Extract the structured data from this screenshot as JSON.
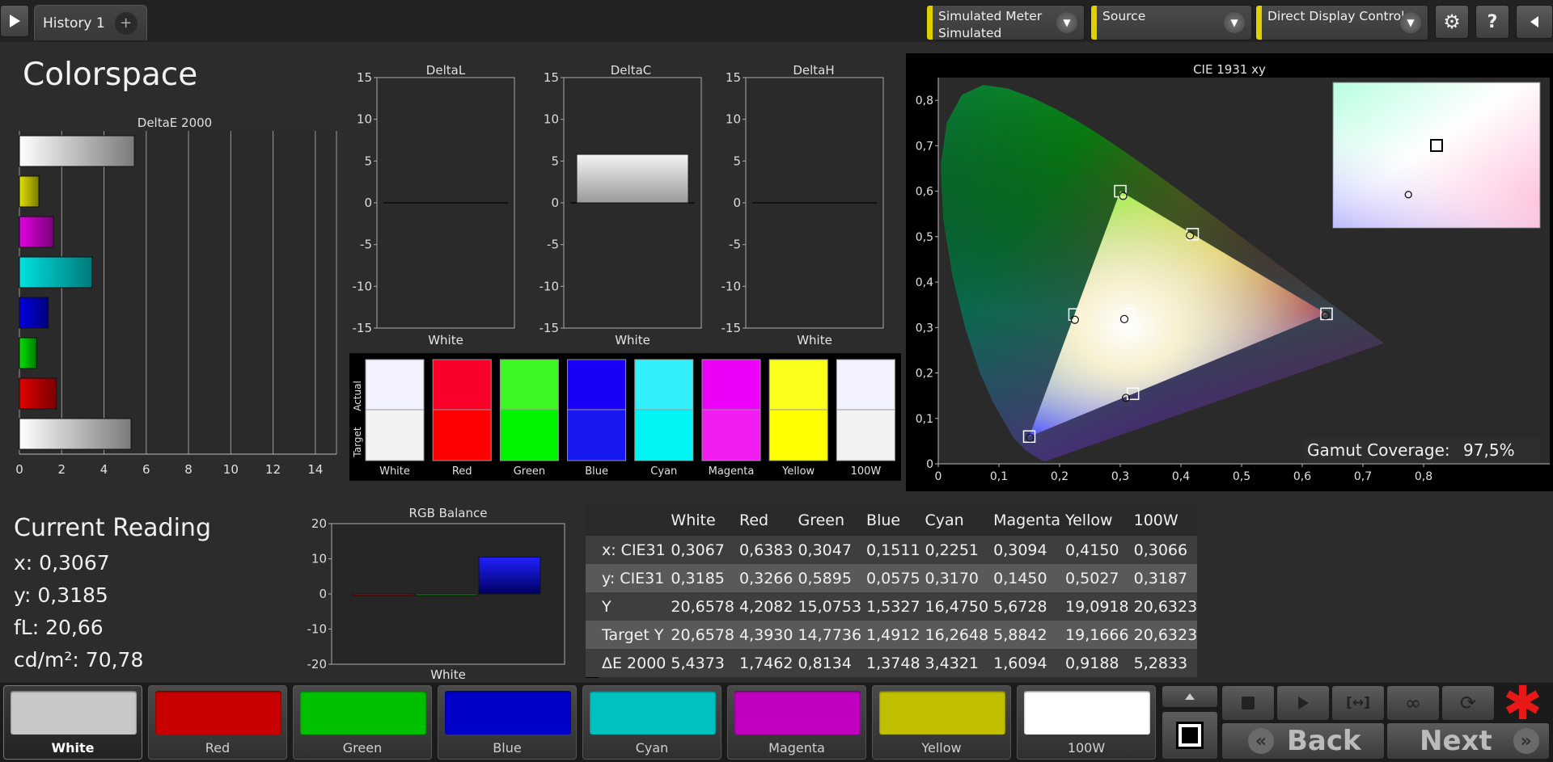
{
  "tabs": {
    "active_label": "History 1",
    "add_label": "+"
  },
  "dropdowns": [
    {
      "line1": "Simulated Meter",
      "line2": "Simulated"
    },
    {
      "line1": "Source",
      "line2": ""
    },
    {
      "line1": "Direct Display Control",
      "line2": ""
    }
  ],
  "icons": {
    "play": "play-icon",
    "settings": "gear-icon",
    "help": "help-icon",
    "collapse": "chevron-left-icon",
    "dropdown": "chevron-down-icon"
  },
  "page_title": "Colorspace",
  "deltaE_chart": {
    "type": "bar",
    "title": "DeltaE 2000",
    "categories": [
      "White",
      "Yellow",
      "Magenta",
      "Cyan",
      "Blue",
      "Green",
      "Red",
      "100W"
    ],
    "values": [
      5.4373,
      0.9188,
      1.6094,
      3.4321,
      1.3748,
      0.8134,
      1.7462,
      5.2833
    ],
    "xlim": [
      0,
      15
    ],
    "ticks": [
      "0",
      "2",
      "4",
      "6",
      "8",
      "10",
      "12",
      "14"
    ]
  },
  "delta_charts": [
    {
      "title": "DeltaL",
      "xlabel": "White",
      "value": 0.0
    },
    {
      "title": "DeltaC",
      "xlabel": "White",
      "value": 5.8
    },
    {
      "title": "DeltaH",
      "xlabel": "White",
      "value": 0.0
    }
  ],
  "delta_ticks": [
    "15",
    "10",
    "5",
    "0",
    "-5",
    "-10",
    "-15"
  ],
  "swatch_compare": {
    "actual_label": "Actual",
    "target_label": "Target",
    "items": [
      {
        "name": "White",
        "actual": "#f2f2fe",
        "target": "#f2f2f2"
      },
      {
        "name": "Red",
        "actual": "#f80028",
        "target": "#ff0000"
      },
      {
        "name": "Green",
        "actual": "#3cf722",
        "target": "#00f400"
      },
      {
        "name": "Blue",
        "actual": "#1800f8",
        "target": "#1717f2"
      },
      {
        "name": "Cyan",
        "actual": "#33eefb",
        "target": "#00f4f4"
      },
      {
        "name": "Magenta",
        "actual": "#ed00f7",
        "target": "#f21bf2"
      },
      {
        "name": "Yellow",
        "actual": "#fbff1c",
        "target": "#ffff00"
      },
      {
        "name": "100W",
        "actual": "#f2f2fe",
        "target": "#f2f2f2"
      }
    ]
  },
  "cie_chart": {
    "title": "CIE 1931 xy",
    "x_ticks": [
      "0",
      "0,1",
      "0,2",
      "0,3",
      "0,4",
      "0,5",
      "0,6",
      "0,7",
      "0,8"
    ],
    "y_ticks": [
      "0",
      "0,1",
      "0,2",
      "0,3",
      "0,4",
      "0,5",
      "0,6",
      "0,7",
      "0,8"
    ],
    "gamut_label": "Gamut Coverage:",
    "gamut_value": "97,5%",
    "targets": [
      {
        "name": "White",
        "x": 0.3127,
        "y": 0.329
      },
      {
        "name": "Red",
        "x": 0.64,
        "y": 0.33
      },
      {
        "name": "Green",
        "x": 0.3,
        "y": 0.6
      },
      {
        "name": "Blue",
        "x": 0.15,
        "y": 0.06
      },
      {
        "name": "Cyan",
        "x": 0.2246,
        "y": 0.3287
      },
      {
        "name": "Magenta",
        "x": 0.3209,
        "y": 0.1542
      },
      {
        "name": "Yellow",
        "x": 0.4193,
        "y": 0.5053
      }
    ],
    "actuals": [
      {
        "name": "White",
        "x": 0.3067,
        "y": 0.3185
      },
      {
        "name": "Red",
        "x": 0.6383,
        "y": 0.3266
      },
      {
        "name": "Green",
        "x": 0.3047,
        "y": 0.5895
      },
      {
        "name": "Blue",
        "x": 0.1511,
        "y": 0.0575
      },
      {
        "name": "Cyan",
        "x": 0.2251,
        "y": 0.317
      },
      {
        "name": "Magenta",
        "x": 0.3094,
        "y": 0.145
      },
      {
        "name": "Yellow",
        "x": 0.415,
        "y": 0.5027
      }
    ]
  },
  "current_reading": {
    "title": "Current Reading",
    "x": "x: 0,3067",
    "y": "y: 0,3185",
    "fl": "fL: 20,66",
    "cdm2": "cd/m²: 70,78"
  },
  "rgb_balance": {
    "title": "RGB Balance",
    "xlabel": "White",
    "ticks": [
      "20",
      "10",
      "0",
      "-10",
      "-20"
    ],
    "values": {
      "red": -0.2,
      "green": -0.4,
      "blue": 10.5
    }
  },
  "table": {
    "columns": [
      "",
      "White",
      "Red",
      "Green",
      "Blue",
      "Cyan",
      "Magenta",
      "Yellow",
      "100W"
    ],
    "rows": [
      [
        "x: CIE31",
        "0,3067",
        "0,6383",
        "0,3047",
        "0,1511",
        "0,2251",
        "0,3094",
        "0,4150",
        "0,3066"
      ],
      [
        "y: CIE31",
        "0,3185",
        "0,3266",
        "0,5895",
        "0,0575",
        "0,3170",
        "0,1450",
        "0,5027",
        "0,3187"
      ],
      [
        "Y",
        "20,6578",
        "4,2082",
        "15,0753",
        "1,5327",
        "16,4750",
        "5,6728",
        "19,0918",
        "20,6323"
      ],
      [
        "Target Y",
        "20,6578",
        "4,3930",
        "14,7736",
        "1,4912",
        "16,2648",
        "5,8842",
        "19,1666",
        "20,6323"
      ],
      [
        "ΔE 2000",
        "5,4373",
        "1,7462",
        "0,8134",
        "1,3748",
        "3,4321",
        "1,6094",
        "0,9188",
        "5,2833"
      ]
    ]
  },
  "bottom_swatches": [
    {
      "label": "White",
      "color": "#c8c8c8",
      "selected": true
    },
    {
      "label": "Red",
      "color": "#c80000",
      "selected": false
    },
    {
      "label": "Green",
      "color": "#00c000",
      "selected": false
    },
    {
      "label": "Blue",
      "color": "#0000c8",
      "selected": false
    },
    {
      "label": "Cyan",
      "color": "#00c0c0",
      "selected": false
    },
    {
      "label": "Magenta",
      "color": "#c000c0",
      "selected": false
    },
    {
      "label": "Yellow",
      "color": "#c0c000",
      "selected": false
    },
    {
      "label": "100W",
      "color": "#ffffff",
      "selected": false
    }
  ],
  "nav": {
    "back_label": "Back",
    "next_label": "Next"
  },
  "accent_color": "#e0d000",
  "star_color": "#e81818"
}
